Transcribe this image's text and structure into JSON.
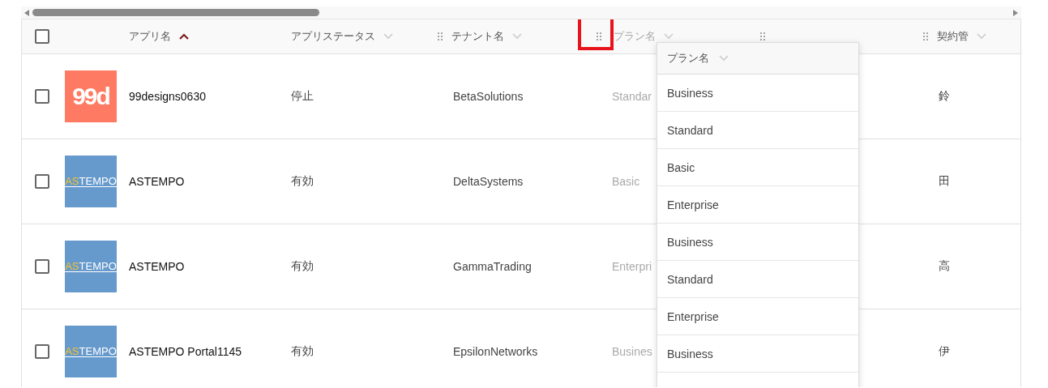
{
  "columns": [
    {
      "kind": "select",
      "checked": false
    },
    {
      "kind": "logo"
    },
    {
      "kind": "text",
      "label": "アプリ名",
      "sorted": true
    },
    {
      "kind": "text",
      "label": "アプリステータス",
      "sorted": false
    },
    {
      "kind": "text",
      "label": "テナント名",
      "sorted": false,
      "handle": true
    },
    {
      "kind": "text",
      "label": "プラン名",
      "sorted": false,
      "handle": true,
      "dragging": true,
      "highlighted": true
    },
    {
      "kind": "text",
      "handle": true
    },
    {
      "kind": "text",
      "label": "契約管",
      "sorted": false,
      "handle": true
    }
  ],
  "rows": [
    {
      "checked": false,
      "logo": {
        "kind": "designs",
        "text": "99d"
      },
      "cells": [
        "99designs0630",
        "停止",
        "BetaSolutions",
        "Standar",
        "",
        "鈴"
      ]
    },
    {
      "checked": false,
      "logo": {
        "kind": "astempo",
        "text": "ASTEMPO"
      },
      "cells": [
        "ASTEMPO",
        "有効",
        "DeltaSystems",
        "Basic",
        "",
        "田"
      ]
    },
    {
      "checked": false,
      "logo": {
        "kind": "astempo",
        "text": "ASTEMPO"
      },
      "cells": [
        "ASTEMPO",
        "有効",
        "GammaTrading",
        "Enterpri",
        "",
        "高"
      ]
    },
    {
      "checked": false,
      "logo": {
        "kind": "astempo",
        "text": "ASTEMPO"
      },
      "cells": [
        "ASTEMPO Portal1145",
        "有効",
        "EpsilonNetworks",
        "Busines",
        "",
        "伊"
      ]
    }
  ],
  "drag_preview": {
    "header": "プラン名",
    "items": [
      "Business",
      "Standard",
      "Basic",
      "Enterprise",
      "Business",
      "Standard",
      "Enterprise",
      "Business"
    ]
  }
}
